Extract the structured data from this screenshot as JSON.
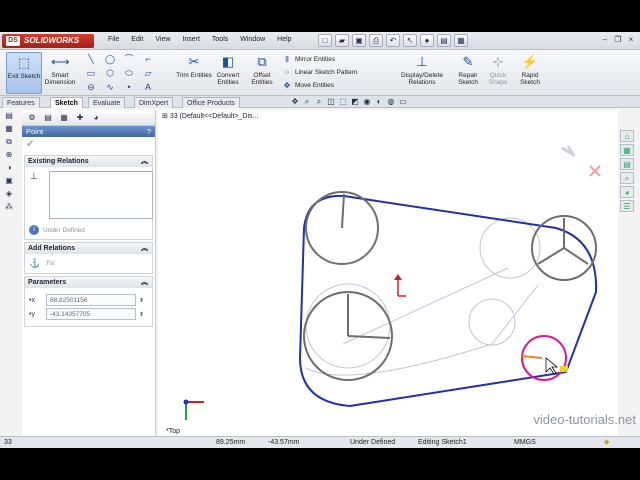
{
  "app": {
    "name": "SOLIDWORKS",
    "logo_mark": "DS"
  },
  "menu": [
    "File",
    "Edit",
    "View",
    "Insert",
    "Tools",
    "Window",
    "Help"
  ],
  "command_manager": {
    "exit_sketch": "Exit Sketch",
    "smart_dimension": "Smart Dimension",
    "trim": "Trim Entities",
    "convert": "Convert Entities",
    "offset": "Offset Entities",
    "mirror": "Mirror Entities",
    "linear_pattern": "Linear Sketch Pattern",
    "move": "Move Entities",
    "display_delete": "Display/Delete Relations",
    "repair": "Repair Sketch",
    "quick_snaps": "Quick Snaps",
    "rapid": "Rapid Sketch"
  },
  "tabs": [
    "Features",
    "Sketch",
    "Evaluate",
    "DimXpert",
    "Office Products"
  ],
  "active_tab": "Sketch",
  "tree_flyout": "33  (Default<<Default>_Dis...",
  "property_manager": {
    "title": "Point",
    "help": "?",
    "existing_relations": "Existing Relations",
    "under_defined": "Under Defined",
    "add_relations": "Add Relations",
    "fix": "Fix",
    "parameters": "Parameters",
    "x_value": "88.82501156",
    "y_value": "-43.14357705"
  },
  "view_label": "*Top",
  "watermark": "video-tutorials.net",
  "status": {
    "doc": "33",
    "x": "89.25mm",
    "y": "-43.57mm",
    "state": "Under Defined",
    "editing": "Editing Sketch1",
    "units": "MMGS"
  },
  "colors": {
    "sketch_blue": "#1f2fb0",
    "construction": "#b9b9c9",
    "selected_pink": "#e0188c",
    "brand_red": "#c0281c"
  }
}
